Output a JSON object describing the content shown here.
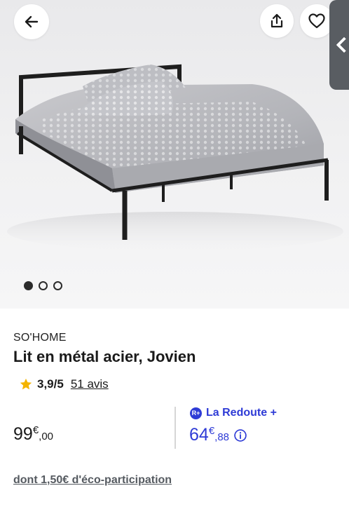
{
  "product": {
    "brand": "SO'HOME",
    "title": "Lit en métal acier, Jovien",
    "rating": {
      "value": "3,9/5",
      "reviews": "51 avis",
      "star_color": "#f4b400"
    },
    "gallery": {
      "count": 3,
      "active_index": 0
    }
  },
  "pricing": {
    "regular": {
      "main": "99",
      "currency": "€",
      "cents": ",00"
    },
    "member": {
      "badge": "R+",
      "label": "La Redoute +",
      "main": "64",
      "currency": "€",
      "cents": ",88"
    },
    "eco_participation": "dont 1,50€ d'éco-participation"
  },
  "icons": {
    "back": "arrow-left-icon",
    "share": "share-icon",
    "favorite": "heart-icon",
    "side_tab": "chevron-left-icon",
    "info": "info-icon"
  },
  "colors": {
    "accent": "#2e3bd6",
    "side_tab": "#595d62"
  }
}
